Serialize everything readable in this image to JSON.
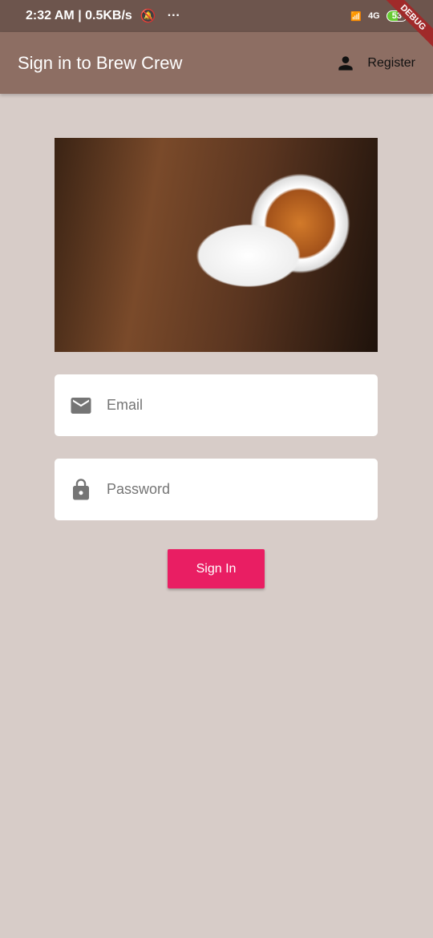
{
  "status": {
    "time": "2:32 AM | 0.5KB/s",
    "dots": "···",
    "network": "4G",
    "battery": "53"
  },
  "debug_banner": "DEBUG",
  "appbar": {
    "title": "Sign in to Brew Crew",
    "register_label": "Register"
  },
  "form": {
    "email_placeholder": "Email",
    "password_placeholder": "Password",
    "submit_label": "Sign In"
  },
  "colors": {
    "appbar": "#8d6e63",
    "background": "#d7ccc8",
    "button": "#e91e63"
  }
}
